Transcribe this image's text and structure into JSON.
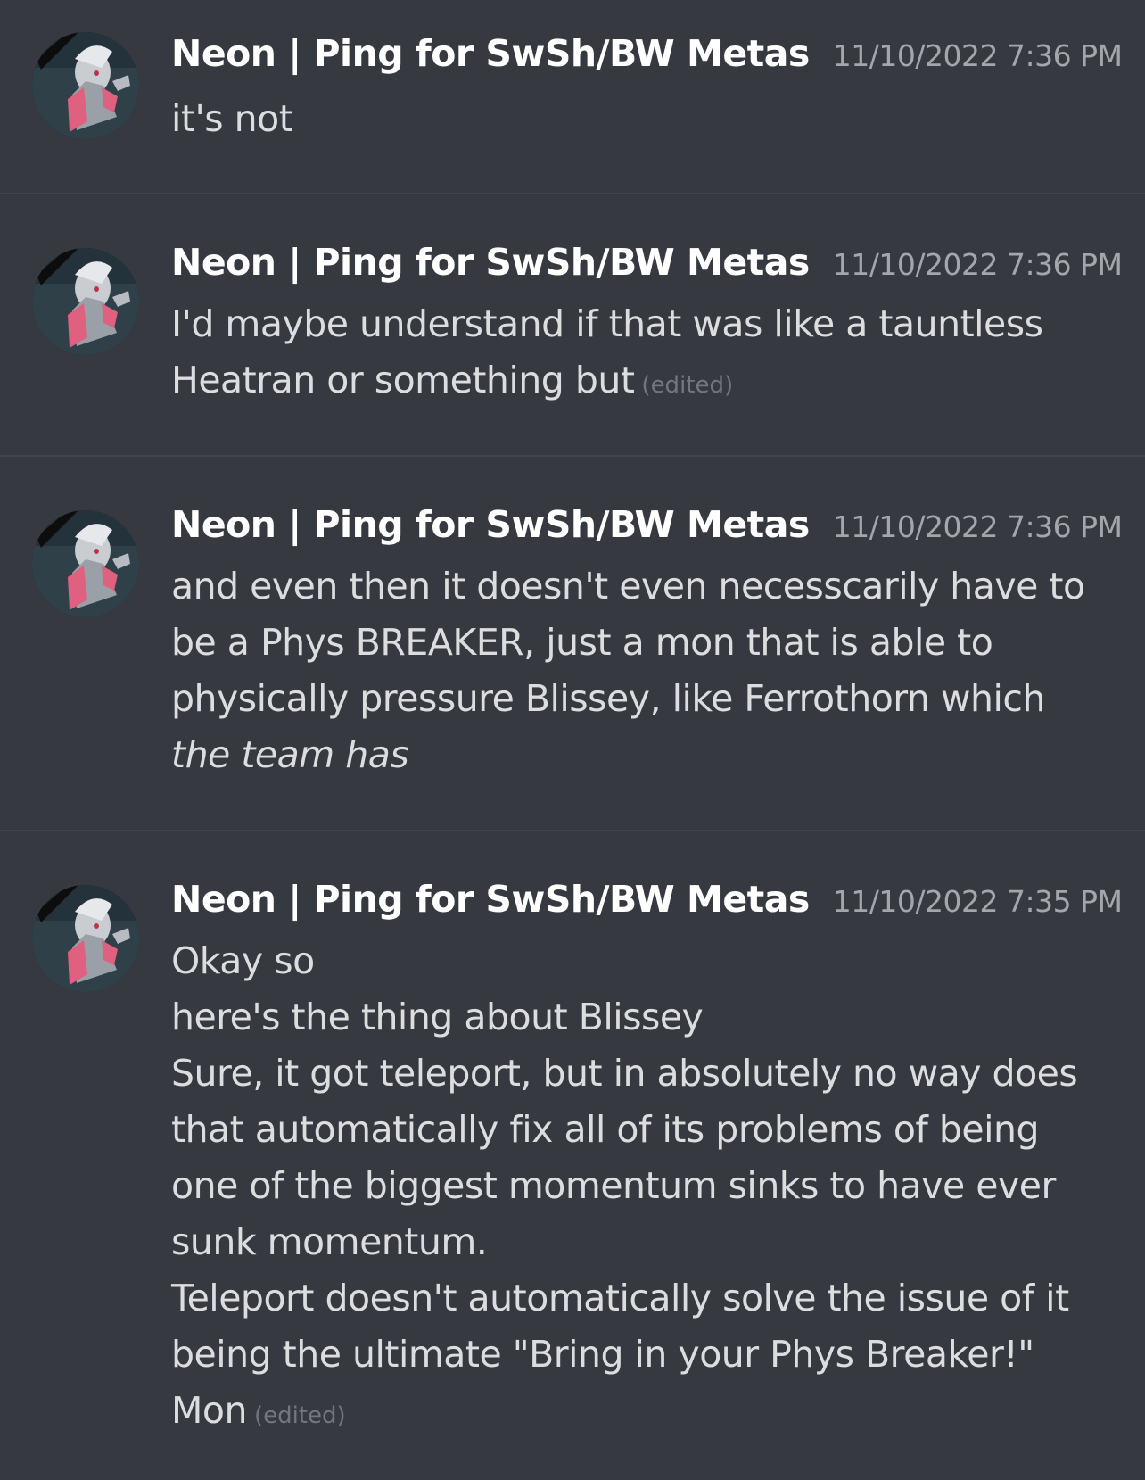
{
  "messages": [
    {
      "username": "Neon | Ping for SwSh/BW Metas",
      "timestamp": "11/10/2022 7:36 PM",
      "avatar_icon": "avatar-icon",
      "lines": [
        "it's not"
      ]
    },
    {
      "username": "Neon | Ping for SwSh/BW Metas",
      "timestamp": "11/10/2022 7:36 PM",
      "avatar_icon": "avatar-icon",
      "lines": [
        "I'd maybe understand if that was like a tauntless",
        "Heatran or something but"
      ],
      "edited_label": "(edited)"
    },
    {
      "username": "Neon | Ping for SwSh/BW Metas",
      "timestamp": "11/10/2022 7:36 PM",
      "avatar_icon": "avatar-icon",
      "lines": [
        "and even then it doesn't even necesscarily have to",
        "be a Phys BREAKER, just a mon that is able to",
        "physically pressure Blissey, like Ferrothorn which",
        "the team has"
      ]
    },
    {
      "username": "Neon | Ping for SwSh/BW Metas",
      "timestamp": "11/10/2022 7:35 PM",
      "avatar_icon": "avatar-icon",
      "lines": [
        "Okay so",
        "here's the thing about Blissey",
        "Sure, it got teleport, but in absolutely no way does",
        "that automatically fix all of its problems of being",
        "one of the biggest momentum sinks to have ever",
        "sunk momentum.",
        "Teleport doesn't automatically solve the issue of it",
        "being the ultimate \"Bring in your Phys Breaker!\"",
        "Mon"
      ],
      "edited_label": "(edited)"
    }
  ],
  "colors": {
    "background": "#36393f",
    "username": "#ffffff",
    "timestamp": "#a3a6aa",
    "text": "#dcddde",
    "edited": "#72767d",
    "divider": "#42454a"
  }
}
